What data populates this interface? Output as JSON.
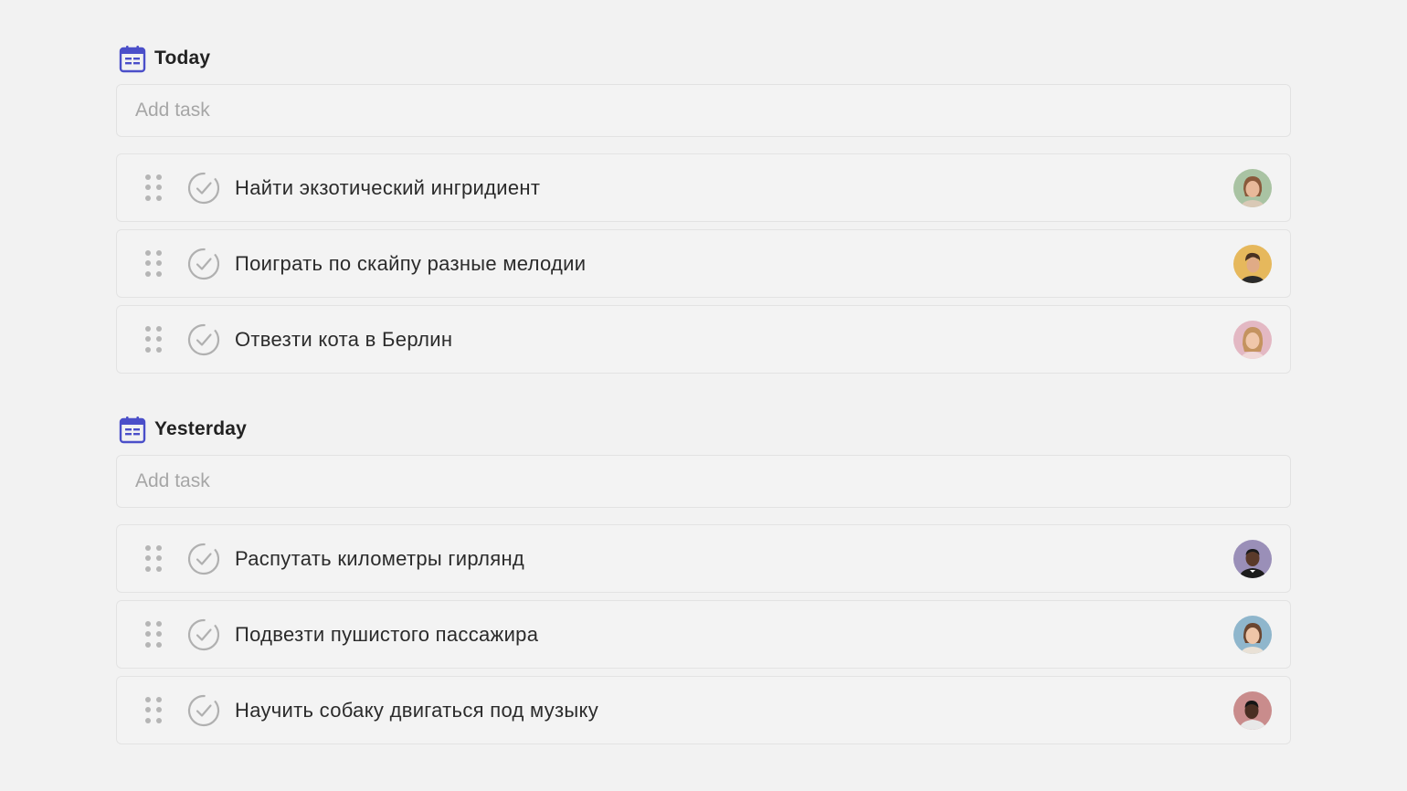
{
  "sections": [
    {
      "title": "Today",
      "icon": "calendar-icon",
      "add_task_placeholder": "Add task",
      "tasks": [
        {
          "title": "Найти экзотический ингридиент",
          "avatar": {
            "bg": "#a9c3a3",
            "skin": "#e8b99a",
            "hair": "#8a5a3b"
          }
        },
        {
          "title": "Поиграть по скайпу разные мелодии",
          "avatar": {
            "bg": "#e6b85c",
            "skin": "#e0ab86",
            "hair": "#4a3222"
          }
        },
        {
          "title": "Отвезти кота в Берлин",
          "avatar": {
            "bg": "#e3b8c3",
            "skin": "#f0c7aa",
            "hair": "#c4935f"
          }
        }
      ]
    },
    {
      "title": "Yesterday",
      "icon": "calendar-icon",
      "add_task_placeholder": "Add task",
      "tasks": [
        {
          "title": "Распутать километры гирлянд",
          "avatar": {
            "bg": "#9a8fb8",
            "skin": "#5a3a2a",
            "hair": "#1a1a1a"
          }
        },
        {
          "title": "Подвезти пушистого пассажира",
          "avatar": {
            "bg": "#8fb6cc",
            "skin": "#efc6a8",
            "hair": "#6b4630"
          }
        },
        {
          "title": "Научить собаку двигаться под музыку",
          "avatar": {
            "bg": "#c98c8c",
            "skin": "#4a2e22",
            "hair": "#151515"
          }
        }
      ]
    }
  ],
  "colors": {
    "accent": "#4b4fc9",
    "background": "#f2f2f2",
    "check": "#b0b0b0"
  }
}
